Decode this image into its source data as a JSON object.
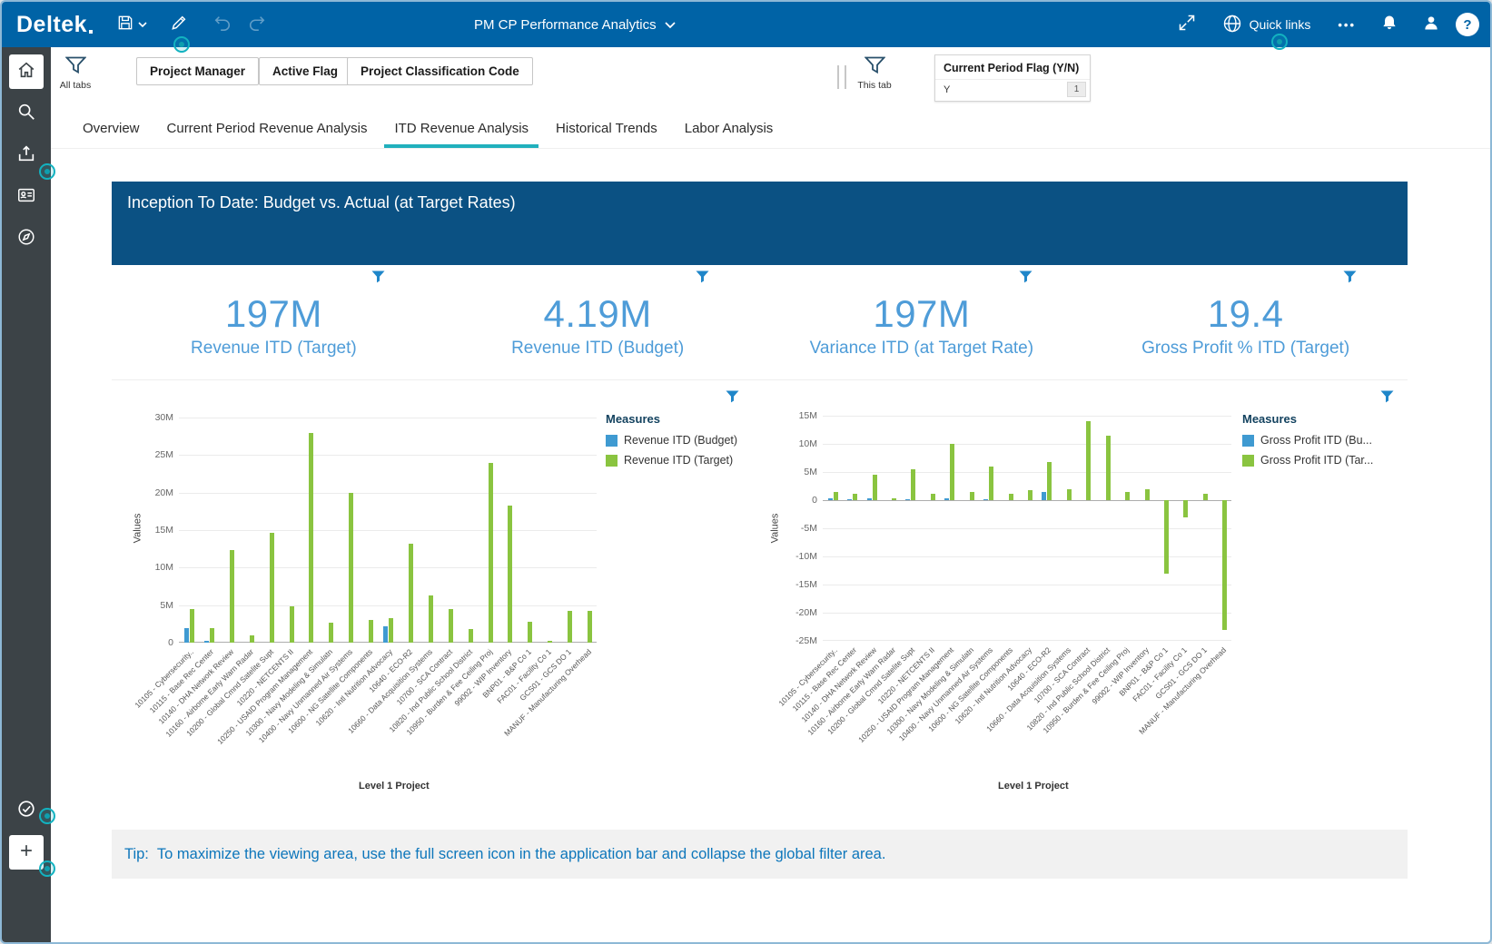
{
  "app": {
    "brand": "Deltek",
    "title": "PM CP Performance Analytics",
    "quick_links_label": "Quick links",
    "more_glyph": "•••",
    "help_glyph": "?"
  },
  "filters": {
    "all_tabs_label": "All tabs",
    "this_tab_label": "This tab",
    "buttons": {
      "project_manager": "Project Manager",
      "active_flag": "Active Flag",
      "project_classification_code": "Project Classification Code"
    },
    "pinned_filter": {
      "title": "Current Period Flag (Y/N)",
      "value": "Y",
      "count": "1"
    }
  },
  "tabs": {
    "items": [
      "Overview",
      "Current Period Revenue Analysis",
      "ITD Revenue Analysis",
      "Historical Trends",
      "Labor Analysis"
    ],
    "active": "ITD Revenue Analysis"
  },
  "banner_title": "Inception To Date:  Budget vs. Actual (at Target Rates)",
  "kpis": [
    {
      "value": "197M",
      "label": "Revenue ITD (Target)"
    },
    {
      "value": "4.19M",
      "label": "Revenue ITD (Budget)"
    },
    {
      "value": "197M",
      "label": "Variance ITD (at Target Rate)"
    },
    {
      "value": "19.4",
      "label": "Gross Profit % ITD (Target)"
    }
  ],
  "tip": {
    "prefix": "Tip:",
    "text": "To maximize the viewing area, use the full screen icon in the application bar and collapse the global filter area."
  },
  "chart_data": [
    {
      "type": "bar",
      "title": "",
      "xlabel": "Level 1 Project",
      "ylabel": "Values",
      "unit": "millions",
      "ylim": [
        0,
        30
      ],
      "yticks": [
        [
          30,
          "30M"
        ],
        [
          25,
          "25M"
        ],
        [
          20,
          "20M"
        ],
        [
          15,
          "15M"
        ],
        [
          10,
          "10M"
        ],
        [
          5,
          "5M"
        ],
        [
          0,
          "0"
        ]
      ],
      "grid": true,
      "legend_title": "Measures",
      "legend_position": "right",
      "categories": [
        "10105 - Cybersecurity..",
        "10115 - Base Rec Center",
        "10140 - DHA Network Review",
        "10160 - Airborne Early Warn Radar",
        "10200 - Global Cmnd Satelite Supt",
        "10220 - NETCENTS II",
        "10250 - USAID Program Management",
        "10300 - Navy Modeling & Simulatn",
        "10400 - Navy Unmanned Air Systems",
        "10600 - NG Satellite Components",
        "10620 - Intl Nutrition Advocacy",
        "10640 - ECO-R2",
        "10660 - Data Acquisition Systems",
        "10700 - SCA Contract",
        "10820 - Ind Public School District",
        "10950 - Burden & Fee Ceiling Proj",
        "99002 - WIP Inventory",
        "BNP01 - B&P Co 1",
        "FAC01 - Facility Co 1",
        "GCS01 - GCS DO 1",
        "MANUF - Manufacturing Overhead"
      ],
      "series": [
        {
          "name": "Revenue ITD (Budget)",
          "color": "#3f9ad1",
          "values": [
            2.0,
            0.3,
            0,
            0,
            0,
            0,
            0,
            0,
            0,
            0,
            2.2,
            0,
            0,
            0,
            0,
            0,
            0,
            0,
            0,
            0,
            0
          ]
        },
        {
          "name": "Revenue ITD (Target)",
          "color": "#8ac440",
          "values": [
            4.5,
            2.0,
            12.3,
            1.0,
            14.7,
            4.8,
            28.0,
            2.7,
            20.0,
            3.0,
            3.3,
            13.2,
            6.3,
            4.5,
            1.8,
            24.0,
            18.3,
            2.8,
            0.2,
            4.3,
            4.3
          ]
        }
      ]
    },
    {
      "type": "bar",
      "title": "",
      "xlabel": "Level 1 Project",
      "ylabel": "Values",
      "unit": "millions",
      "ylim": [
        -25,
        15
      ],
      "yticks": [
        [
          15,
          "15M"
        ],
        [
          10,
          "10M"
        ],
        [
          5,
          "5M"
        ],
        [
          0,
          "0"
        ],
        [
          -5,
          "-5M"
        ],
        [
          -10,
          "-10M"
        ],
        [
          -15,
          "-15M"
        ],
        [
          -20,
          "-20M"
        ],
        [
          -25,
          "-25M"
        ]
      ],
      "grid": true,
      "legend_title": "Measures",
      "legend_position": "right",
      "categories": [
        "10105 - Cybersecurity..",
        "10115 - Base Rec Center",
        "10140 - DHA Network Review",
        "10160 - Airborne Early Warn Radar",
        "10200 - Global Cmnd Satelite Supt",
        "10220 - NETCENTS II",
        "10250 - USAID Program Management",
        "10300 - Navy Modeling & Simulatn",
        "10400 - Navy Unmanned Air Systems",
        "10600 - NG Satellite Components",
        "10620 - Intl Nutrition Advocacy",
        "10640 - ECO-R2",
        "10660 - Data Acquisition Systems",
        "10700 - SCA Contract",
        "10820 - Ind Public School District",
        "10950 - Burden & Fee Ceiling Proj",
        "99002 - WIP Inventory",
        "BNP01 - B&P Co 1",
        "FAC01 - Facility Co 1",
        "GCS01 - GCS DO 1",
        "MANUF - Manufacturing Overhead"
      ],
      "series": [
        {
          "name": "Gross Profit ITD (Bu...",
          "color": "#3f9ad1",
          "values": [
            0.3,
            0.2,
            0.3,
            0,
            0.2,
            0,
            0.3,
            0,
            0.2,
            0,
            0,
            1.5,
            0,
            0,
            0,
            0,
            0,
            0,
            0,
            0,
            0
          ]
        },
        {
          "name": "Gross Profit ITD (Tar...",
          "color": "#8ac440",
          "values": [
            1.5,
            1.2,
            4.5,
            0.3,
            5.5,
            1.2,
            10.0,
            1.5,
            6.0,
            1.2,
            1.8,
            6.8,
            2.0,
            14.0,
            11.5,
            1.5,
            2.0,
            -13.0,
            -3.0,
            1.2,
            -23.0
          ]
        }
      ]
    }
  ]
}
